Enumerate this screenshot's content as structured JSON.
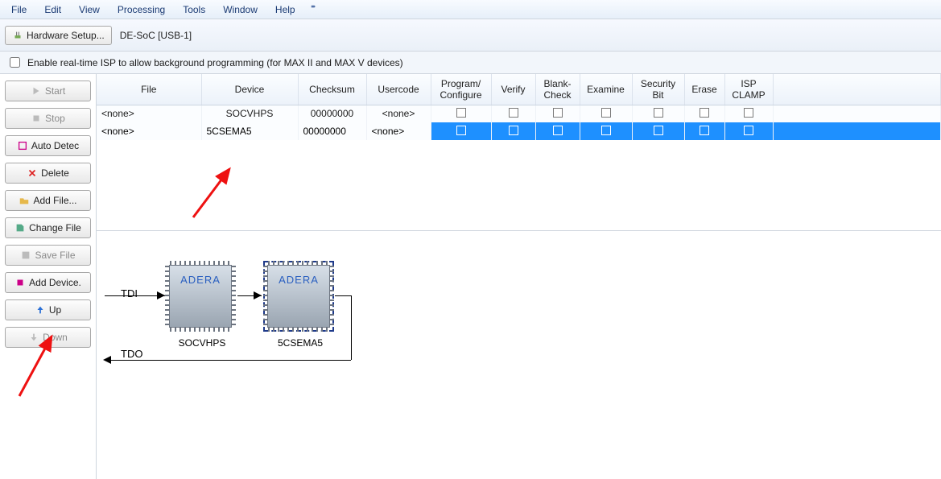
{
  "menubar": [
    "File",
    "Edit",
    "View",
    "Processing",
    "Tools",
    "Window",
    "Help"
  ],
  "toolbar": {
    "hw_setup_label": "Hardware Setup...",
    "hw_name": "DE-SoC [USB-1]"
  },
  "realtime_isp_label": "Enable real-time ISP to allow background programming (for MAX II and MAX V devices)",
  "sidebar": {
    "start": "Start",
    "stop": "Stop",
    "auto_detect": "Auto Detec",
    "delete": "Delete",
    "add_file": "Add File...",
    "change_file": "Change File",
    "save_file": "Save File",
    "add_device": "Add Device.",
    "up": "Up",
    "down": "Down"
  },
  "table": {
    "headers": {
      "file": "File",
      "device": "Device",
      "checksum": "Checksum",
      "usercode": "Usercode",
      "program": "Program/\nConfigure",
      "verify": "Verify",
      "blank": "Blank-\nCheck",
      "examine": "Examine",
      "security": "Security\nBit",
      "erase": "Erase",
      "isp": "ISP\nCLAMP"
    },
    "rows": [
      {
        "file": "<none>",
        "device": "SOCVHPS",
        "checksum": "00000000",
        "usercode": "<none>",
        "selected": false
      },
      {
        "file": "<none>",
        "device": "5CSEMA5",
        "checksum": "00000000",
        "usercode": "<none>",
        "selected": true
      }
    ]
  },
  "diagram": {
    "tdi": "TDI",
    "tdo": "TDO",
    "chip1_brand": "ADERA",
    "chip1_name": "SOCVHPS",
    "chip2_brand": "ADERA",
    "chip2_name": "5CSEMA5"
  }
}
